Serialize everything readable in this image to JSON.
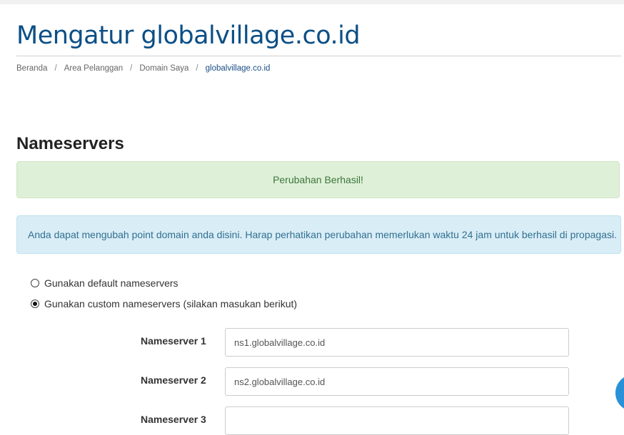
{
  "page": {
    "title": "Mengatur globalvillage.co.id"
  },
  "breadcrumb": {
    "items": [
      "Beranda",
      "Area Pelanggan",
      "Domain Saya"
    ],
    "separator": "/",
    "active": "globalvillage.co.id"
  },
  "section": {
    "title": "Nameservers"
  },
  "alerts": {
    "success": "Perubahan Berhasil!",
    "info": "Anda dapat mengubah point domain anda disini. Harap perhatikan perubahan memerlukan waktu 24 jam untuk berhasil di propagasi."
  },
  "options": {
    "default_label": "Gunakan default nameservers",
    "custom_label": "Gunakan custom nameservers (silakan masukan berikut)",
    "selected": "custom"
  },
  "nameservers": [
    {
      "label": "Nameserver 1",
      "value": "ns1.globalvillage.co.id"
    },
    {
      "label": "Nameserver 2",
      "value": "ns2.globalvillage.co.id"
    },
    {
      "label": "Nameserver 3",
      "value": ""
    }
  ],
  "colors": {
    "title": "#0b4f86",
    "success_bg": "#dff0d8",
    "success_text": "#3c763d",
    "info_bg": "#d9edf7",
    "info_text": "#31708f",
    "fab": "#2a91d8"
  }
}
